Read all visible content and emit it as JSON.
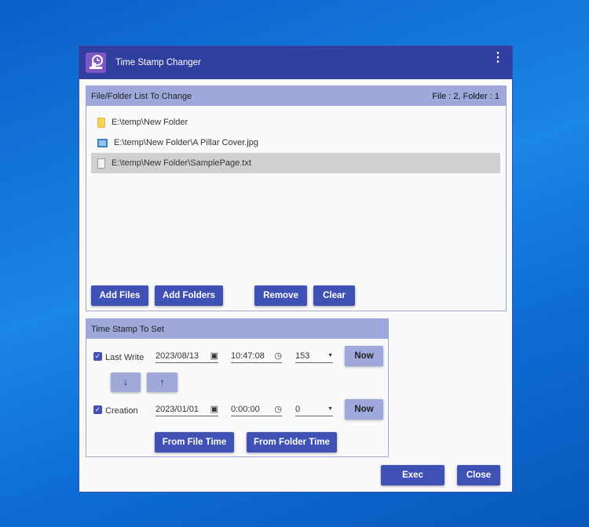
{
  "window": {
    "title": "Time Stamp Changer"
  },
  "list_panel": {
    "title": "File/Folder List To Change",
    "count": "File : 2, Folder : 1",
    "items": [
      {
        "path": "E:\\temp\\New Folder",
        "type": "folder"
      },
      {
        "path": "E:\\temp\\New Folder\\A Pillar Cover.jpg",
        "type": "image"
      },
      {
        "path": "E:\\temp\\New Folder\\SamplePage.txt",
        "type": "text",
        "selected": true
      }
    ],
    "add_files": "Add Files",
    "add_folders": "Add Folders",
    "remove": "Remove",
    "clear": "Clear"
  },
  "stamp_panel": {
    "title": "Time Stamp To Set",
    "last_write": {
      "label": "Last Write",
      "checked": true,
      "date": "2023/08/13",
      "time": "10:47:08",
      "ms": "153",
      "now": "Now"
    },
    "creation": {
      "label": "Creation",
      "checked": true,
      "date": "2023/01/01",
      "time": "0:00:00",
      "ms": "0",
      "now": "Now"
    },
    "down": "↓",
    "up": "↑",
    "from_file": "From File Time",
    "from_folder": "From Folder Time"
  },
  "exec": "Exec",
  "close": "Close"
}
